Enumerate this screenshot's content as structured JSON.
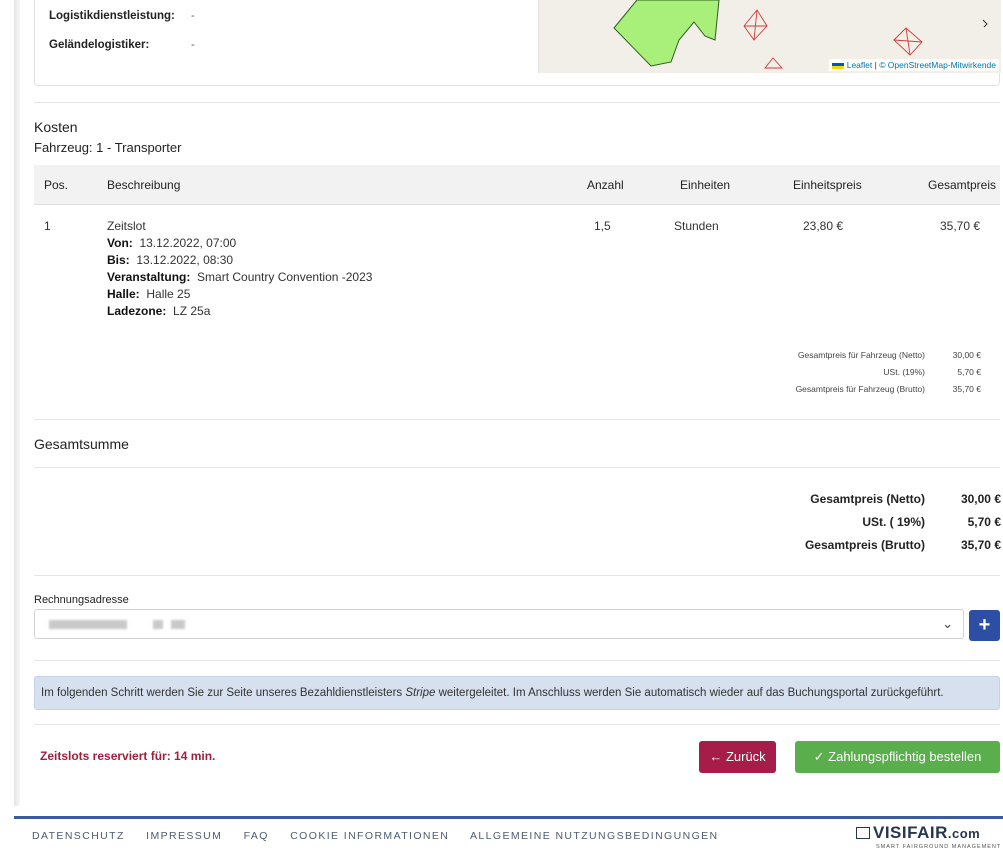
{
  "info": {
    "rows": [
      {
        "label": "Logistikdienstleistung:",
        "value": "-"
      },
      {
        "label": "Geländelogistiker:",
        "value": "-"
      }
    ],
    "map_attribution": {
      "leaflet": "Leaflet",
      "osm": "© OpenStreetMap-Mitwirkende"
    }
  },
  "costs": {
    "title": "Kosten",
    "vehicle": "Fahrzeug: 1 - Transporter",
    "headers": {
      "pos": "Pos.",
      "desc": "Beschreibung",
      "qty": "Anzahl",
      "units": "Einheiten",
      "unit_price": "Einheitspreis",
      "total": "Gesamtpreis"
    },
    "row": {
      "pos": "1",
      "desc": "Zeitslot",
      "qty": "1,5",
      "units": "Stunden",
      "unit_price": "23,80 €",
      "total": "35,70 €",
      "details": [
        {
          "label": "Von:",
          "value": "13.12.2022, 07:00"
        },
        {
          "label": "Bis:",
          "value": "13.12.2022, 08:30"
        },
        {
          "label": "Veranstaltung:",
          "value": "Smart Country Convention -2023"
        },
        {
          "label": "Halle:",
          "value": "Halle 25"
        },
        {
          "label": "Ladezone:",
          "value": "LZ 25a"
        }
      ]
    },
    "vehicle_sums": [
      {
        "label": "Gesamtpreis für Fahrzeug (Netto)",
        "value": "30,00 €"
      },
      {
        "label": "USt. (19%)",
        "value": "5,70 €"
      },
      {
        "label": "Gesamtpreis für Fahrzeug (Brutto)",
        "value": "35,70 €"
      }
    ]
  },
  "total": {
    "title": "Gesamtsumme",
    "rows": [
      {
        "label": "Gesamtpreis (Netto)",
        "value": "30,00 €"
      },
      {
        "label": "USt. ( 19%)",
        "value": "5,70 €"
      },
      {
        "label": "Gesamtpreis (Brutto)",
        "value": "35,70 €"
      }
    ]
  },
  "address": {
    "label": "Rechnungsadresse",
    "add_symbol": "+"
  },
  "notice": {
    "before": "Im folgenden Schritt werden Sie zur Seite unseres Bezahldienstleisters ",
    "provider": "Stripe",
    "after": " weitergeleitet. Im Anschluss werden Sie automatisch wieder auf das Buchungsportal zurückgeführt."
  },
  "actions": {
    "timer": "Zeitslots reserviert für: 14 min.",
    "back": "← Zurück",
    "order": "✓ Zahlungspflichtig bestellen"
  },
  "footer": {
    "links": [
      "DATENSCHUTZ",
      "IMPRESSUM",
      "FAQ",
      "COOKIE INFORMATIONEN",
      "ALLGEMEINE NUTZUNGSBEDINGUNGEN"
    ],
    "logo_text": "VISIFAIR",
    "logo_suffix": ".com",
    "logo_sub": "SMART FAIRGROUND MANAGEMENT"
  },
  "colors": {
    "primary": "#2d4fa3",
    "danger": "#a51d48",
    "success": "#5aae4c",
    "notice_bg": "#d7e0ee"
  },
  "icons": {
    "select": "chevron-down-icon",
    "add": "plus-icon",
    "back": "arrow-left-icon",
    "order": "check-icon"
  }
}
